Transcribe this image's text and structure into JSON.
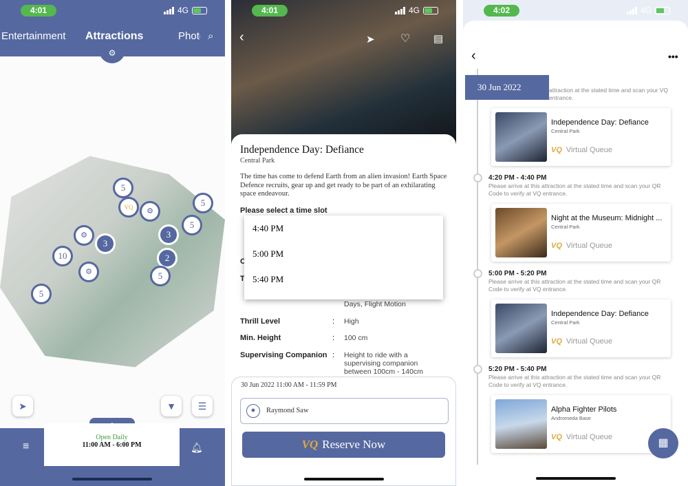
{
  "time1": "4:01",
  "time2": "4:01",
  "time3": "4:02",
  "network": "4G",
  "s1": {
    "tab_left": "Entertainment",
    "tab_center": "Attractions",
    "tab_right": "Photo",
    "pins": [
      "5",
      "5",
      "3",
      "3",
      "5",
      "2",
      "10",
      "5",
      "5"
    ],
    "hours_label": "Open Daily",
    "hours_value": "11:00 AM - 6:00 PM"
  },
  "s2": {
    "title": "Independence Day: Defiance",
    "location": "Central Park",
    "description": "The time has come to defend Earth from an alien invasion! Earth Space Defence recruits, gear up and get ready to be part of an exhilarating space endeavour.",
    "select_label": "Please select a time slot",
    "time_options": [
      "4:40 PM",
      "5:00 PM",
      "5:40 PM"
    ],
    "hidden_rows": [
      "O",
      "T"
    ],
    "partial_value": "Days, Flight Motion",
    "thrill_label": "Thrill Level",
    "thrill_value": "High",
    "height_label": "Min. Height",
    "height_value": "100 cm",
    "companion_label": "Supervising Companion",
    "companion_value": "Height to ride with a supervising companion between 100cm - 140cm",
    "session": "30 Jun 2022  11:00 AM - 11:59 PM",
    "guest": "Raymond Saw",
    "vq_logo": "VQ",
    "reserve": "Reserve Now"
  },
  "s3": {
    "date": "30 Jun 2022",
    "note": "Please arrive at this attraction at the stated time and scan your QR Code to verify at VQ entrance.",
    "note_top": "attraction at the stated time and scan your VQ entrance.",
    "vq_logo": "VQ",
    "vq_label": "Virtual Queue",
    "slots": [
      "4:20 PM - 4:40 PM",
      "5:00 PM - 5:20 PM",
      "5:20 PM - 5:40 PM"
    ],
    "items": [
      {
        "name": "Independence Day: Defiance",
        "loc": "Central Park"
      },
      {
        "name": "Night at the Museum: Midnight ...",
        "loc": "Central Park"
      },
      {
        "name": "Independence Day: Defiance",
        "loc": "Central Park"
      },
      {
        "name": "Alpha Fighter Pilots",
        "loc": "Andromeda Base"
      }
    ]
  }
}
